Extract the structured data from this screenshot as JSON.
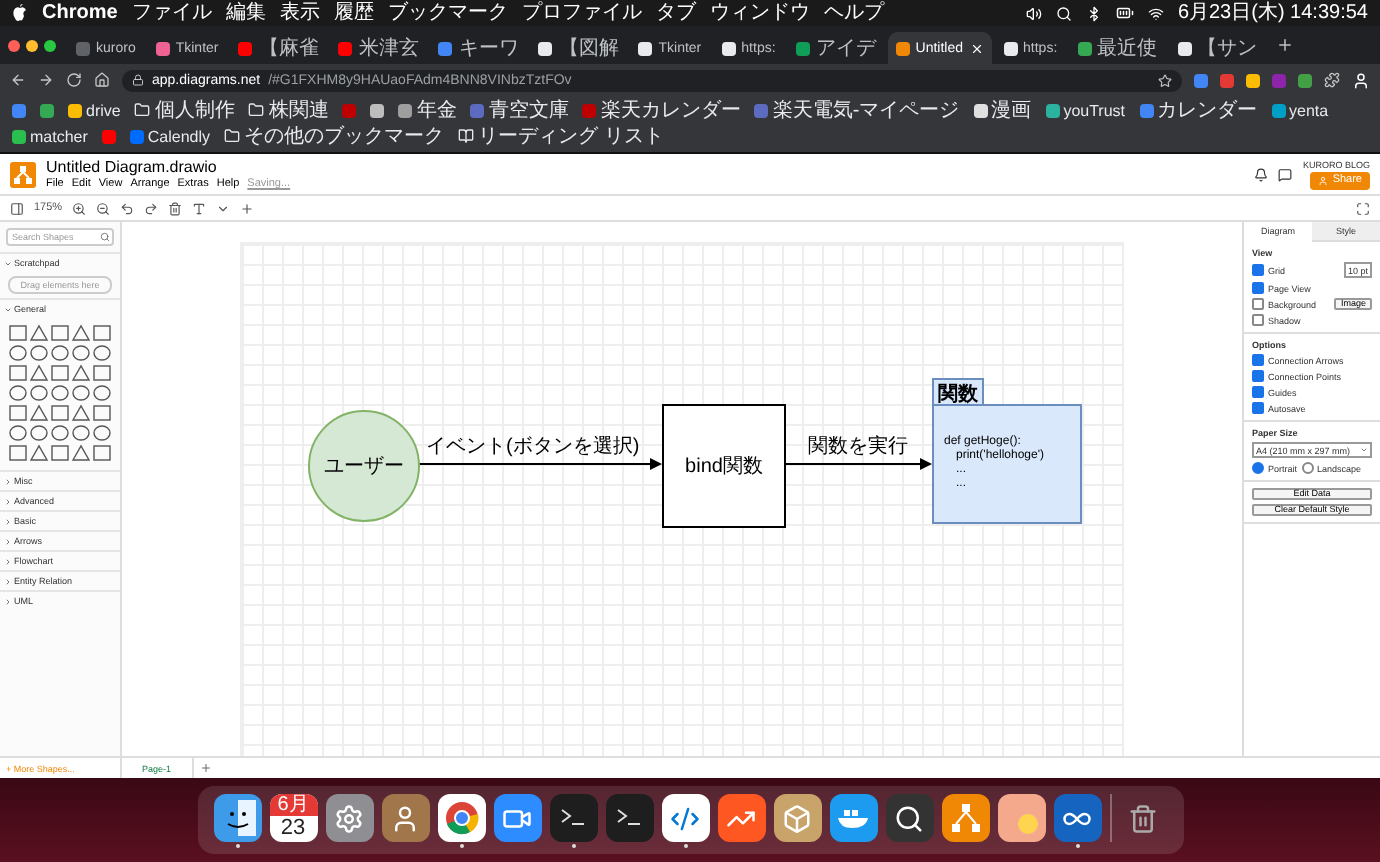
{
  "menubar": {
    "app": "Chrome",
    "menus": [
      "ファイル",
      "編集",
      "表示",
      "履歴",
      "ブックマーク",
      "プロファイル",
      "タブ",
      "ウィンドウ",
      "ヘルプ"
    ],
    "clock": "6月23日(木) 14:39:54"
  },
  "tabs": [
    {
      "title": "kuroro",
      "color": "#5f6368",
      "selected": false
    },
    {
      "title": "Tkinter",
      "color": "#f06292",
      "selected": false
    },
    {
      "title": "【麻雀",
      "color": "#ff0000",
      "selected": false
    },
    {
      "title": "米津玄",
      "color": "#ff0000",
      "selected": false
    },
    {
      "title": "キーワ",
      "color": "#4285f4",
      "selected": false
    },
    {
      "title": "【図解",
      "color": "#e8eaed",
      "selected": false
    },
    {
      "title": "Tkinter",
      "color": "#e8eaed",
      "selected": false
    },
    {
      "title": "https:",
      "color": "#e8eaed",
      "selected": false
    },
    {
      "title": "アイデ",
      "color": "#0f9d58",
      "selected": false
    },
    {
      "title": "Untitled",
      "color": "#f08705",
      "selected": true
    },
    {
      "title": "https:",
      "color": "#e8eaed",
      "selected": false
    },
    {
      "title": "最近使",
      "color": "#34a853",
      "selected": false
    },
    {
      "title": "【サン",
      "color": "#e8eaed",
      "selected": false
    }
  ],
  "address": {
    "host": "app.diagrams.net",
    "path": "/#G1FXHM8y9HAUaoFAdm4BNN8VINbzTztFOv"
  },
  "bookmarks": [
    {
      "kind": "site",
      "color": "#4285f4"
    },
    {
      "kind": "site",
      "color": "#34a853"
    },
    {
      "kind": "site",
      "color": "#fbbc04",
      "label": "drive"
    },
    {
      "kind": "folder",
      "label": "個人制作"
    },
    {
      "kind": "folder",
      "label": "株関連"
    },
    {
      "kind": "site",
      "color": "#bf0000"
    },
    {
      "kind": "site",
      "color": "#bdbdbd"
    },
    {
      "kind": "site",
      "color": "#9e9e9e",
      "label": "年金"
    },
    {
      "kind": "site",
      "color": "#5c6bc0",
      "label": "青空文庫"
    },
    {
      "kind": "site",
      "color": "#bf0000",
      "label": "楽天カレンダー"
    },
    {
      "kind": "site",
      "color": "#5c6bc0",
      "label": "楽天電気-マイページ"
    },
    {
      "kind": "site",
      "color": "#e0e0e0",
      "label": "漫画"
    },
    {
      "kind": "site",
      "color": "#2bb3a0",
      "label": "youTrust"
    },
    {
      "kind": "site",
      "color": "#4285f4",
      "label": "カレンダー"
    },
    {
      "kind": "site",
      "color": "#00a0c6",
      "label": "yenta"
    },
    {
      "kind": "site",
      "color": "#2bbf4f",
      "label": "matcher"
    },
    {
      "kind": "site",
      "color": "#ff0000"
    },
    {
      "kind": "site",
      "color": "#006bff",
      "label": "Calendly"
    },
    {
      "kind": "folder",
      "label": "その他のブックマーク"
    },
    {
      "kind": "reading",
      "label": "リーディング リスト"
    }
  ],
  "app": {
    "file_title": "Untitled Diagram.drawio",
    "menus": [
      "File",
      "Edit",
      "View",
      "Arrange",
      "Extras",
      "Help"
    ],
    "status": "Saving...",
    "account": "KURORO BLOG",
    "share": "Share",
    "zoom": "175%"
  },
  "sidebar": {
    "search_placeholder": "Search Shapes",
    "scratchpad": {
      "title": "Scratchpad",
      "hint": "Drag elements here",
      "expanded": true
    },
    "general": {
      "title": "General",
      "expanded": true
    },
    "sections": [
      {
        "title": "Misc",
        "expanded": false
      },
      {
        "title": "Advanced",
        "expanded": false
      },
      {
        "title": "Basic",
        "expanded": false
      },
      {
        "title": "Arrows",
        "expanded": false
      },
      {
        "title": "Flowchart",
        "expanded": false
      },
      {
        "title": "Entity Relation",
        "expanded": false
      },
      {
        "title": "UML",
        "expanded": false
      }
    ],
    "more_shapes": "+ More Shapes..."
  },
  "diagram": {
    "user": "ユーザー",
    "bind": "bind関数",
    "function_title": "関数",
    "code": [
      "def getHoge():",
      "print('hellohoge')",
      "...",
      "..."
    ],
    "edge_labels": [
      "イベント(ボタンを選択)",
      "関数を実行"
    ]
  },
  "format_panel": {
    "tabs": [
      {
        "label": "Diagram",
        "selected": true
      },
      {
        "label": "Style",
        "selected": false
      }
    ],
    "view_title": "View",
    "view_options": [
      {
        "label": "Grid",
        "checked": true
      },
      {
        "label": "Page View",
        "checked": true
      },
      {
        "label": "Background",
        "checked": false
      },
      {
        "label": "Shadow",
        "checked": false
      }
    ],
    "grid_size": "10 pt",
    "image_button": "Image",
    "options_title": "Options",
    "options": [
      {
        "label": "Connection Arrows",
        "checked": true
      },
      {
        "label": "Connection Points",
        "checked": true
      },
      {
        "label": "Guides",
        "checked": true
      },
      {
        "label": "Autosave",
        "checked": true
      }
    ],
    "paper_title": "Paper Size",
    "paper": "A4 (210 mm x 297 mm)",
    "orientations": [
      {
        "label": "Portrait",
        "selected": true
      },
      {
        "label": "Landscape",
        "selected": false
      }
    ],
    "buttons": [
      "Edit Data",
      "Clear Default Style"
    ]
  },
  "pages": [
    {
      "label": "Page-1",
      "selected": true
    }
  ],
  "dock": {
    "calendar_month": "6月",
    "calendar_day": "23",
    "apps": [
      {
        "kind": "finder",
        "running": true
      },
      {
        "kind": "calendar",
        "running": false
      },
      {
        "kind": "settings",
        "running": false
      },
      {
        "kind": "contacts",
        "running": false
      },
      {
        "kind": "chrome",
        "running": true
      },
      {
        "kind": "zoom",
        "running": false
      },
      {
        "kind": "terminal",
        "running": true
      },
      {
        "kind": "terminal",
        "running": false
      },
      {
        "kind": "vscode",
        "running": true
      },
      {
        "kind": "chart",
        "running": false
      },
      {
        "kind": "box",
        "running": false
      },
      {
        "kind": "docker",
        "running": false
      },
      {
        "kind": "quicktime",
        "running": false
      },
      {
        "kind": "drawio",
        "running": false
      },
      {
        "kind": "preview",
        "running": false
      },
      {
        "kind": "infinity",
        "running": true
      },
      {
        "kind": "trash",
        "running": false
      }
    ]
  }
}
